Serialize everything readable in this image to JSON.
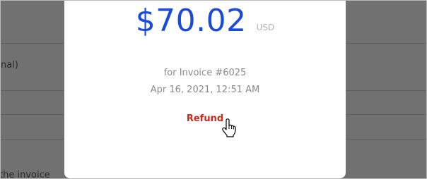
{
  "background": {
    "partial_text_1": "nal)",
    "partial_text_2": "the invoice"
  },
  "payment_modal": {
    "amount": "$70.02",
    "currency": "USD",
    "invoice_label": "for Invoice #6025",
    "timestamp": "Apr 16, 2021, 12:51 AM",
    "refund_label": "Refund"
  },
  "colors": {
    "amount": "#1a4ad8",
    "refund": "#d0281e",
    "muted_text": "#8a8a8a",
    "overlay": "#717171"
  },
  "icons": {
    "cursor": "hand-pointer-icon"
  }
}
